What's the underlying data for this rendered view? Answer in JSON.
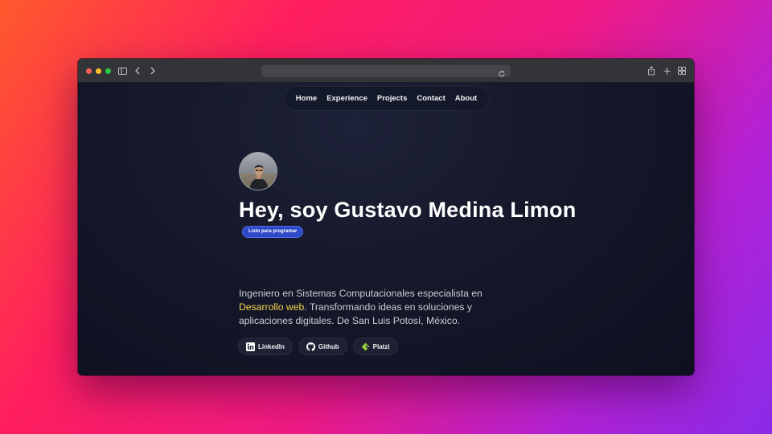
{
  "browser": {
    "controls": {
      "sidebar_icon": "sidebar-icon",
      "back_icon": "chevron-left-icon",
      "forward_icon": "chevron-right-icon",
      "reload_icon": "reload-icon",
      "share_icon": "share-icon",
      "new_tab_icon": "plus-icon",
      "tabs_icon": "tab-overview-icon"
    },
    "traffic_light_colors": [
      "#fe5f57",
      "#febc2e",
      "#28c840"
    ]
  },
  "nav": {
    "items": [
      {
        "label": "Home"
      },
      {
        "label": "Experience"
      },
      {
        "label": "Projects"
      },
      {
        "label": "Contact"
      },
      {
        "label": "About"
      }
    ]
  },
  "hero": {
    "title": "Hey, soy Gustavo Medina Limon",
    "badge": "Listo para programar",
    "bio_before": "Ingeniero en Sistemas Computacionales especialista en ",
    "bio_highlight": "Desarrollo web",
    "bio_after": ". Transformando ideas en soluciones y aplicaciones digitales. De San Luis Potosí, México.",
    "accent_color": "#f2d24a"
  },
  "socials": [
    {
      "label": "LinkedIn",
      "icon": "linkedin-icon"
    },
    {
      "label": "Github",
      "icon": "github-icon"
    },
    {
      "label": "Platzi",
      "icon": "platzi-icon"
    }
  ]
}
